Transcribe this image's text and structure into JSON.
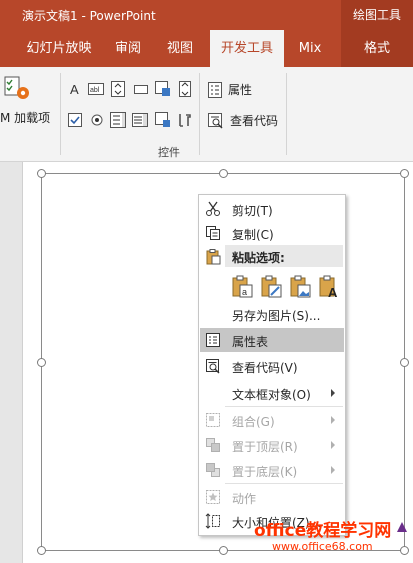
{
  "titlebar": {
    "title": "演示文稿1  -  PowerPoint",
    "context_title": "绘图工具"
  },
  "tabs": [
    {
      "label": "幻灯片放映"
    },
    {
      "label": "审阅"
    },
    {
      "label": "视图"
    },
    {
      "label": "开发工具",
      "active": true
    },
    {
      "label": "Mix"
    },
    {
      "label": "格式",
      "context": true
    }
  ],
  "ribbon": {
    "addins_label": "M 加载项",
    "properties_label": "属性",
    "view_code_label": "查看代码",
    "group_label": "控件",
    "control_icons": [
      "label-control-icon",
      "textbox-control-icon",
      "spin-control-icon",
      "button-control-icon",
      "image-control-icon",
      "scrollbar-control-icon",
      "checkbox-control-icon",
      "radio-control-icon",
      "listbox-control-icon",
      "combobox-control-icon",
      "toggle-control-icon",
      "more-controls-icon"
    ]
  },
  "context_menu": {
    "cut": "剪切(T)",
    "copy": "复制(C)",
    "paste_header": "粘贴选项:",
    "paste_options": [
      "paste-theme-icon",
      "paste-keep-format-icon",
      "paste-picture-icon",
      "paste-text-only-icon"
    ],
    "save_as_picture": "另存为图片(S)...",
    "properties": "属性表",
    "view_code": "查看代码(V)",
    "textbox_object": "文本框对象(O)",
    "group": "组合(G)",
    "bring_to_front": "置于顶层(R)",
    "send_to_back": "置于底层(K)",
    "animation": "动作",
    "size_position": "大小和位置(Z)..."
  },
  "watermark": {
    "line1": "office教程学习网",
    "line2": "www.office68.com"
  },
  "colors": {
    "accent": "#b7472a",
    "context_tab": "#a33b21",
    "ribbon_bg": "#f3f3f3",
    "menu_highlight": "#c6c6c6",
    "watermark": "#ff3300"
  }
}
